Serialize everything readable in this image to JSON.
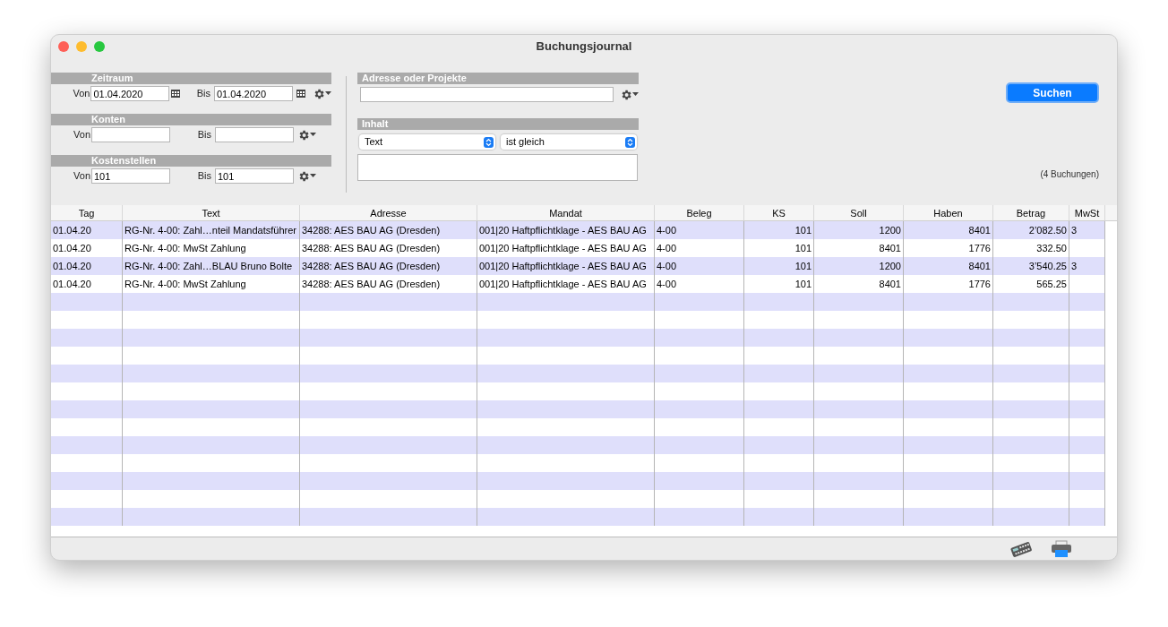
{
  "window": {
    "title": "Buchungsjournal"
  },
  "filters": [
    {
      "title": "Zeitraum",
      "from_label": "Von",
      "from_value": "01.04.2020",
      "to_label": "Bis",
      "to_value": "01.04.2020",
      "calendar": true
    },
    {
      "title": "Konten",
      "from_label": "Von",
      "to_label": "Bis",
      "calendar": false
    },
    {
      "title": "Kostenstellen",
      "from_label": "Von",
      "from_value": "101",
      "to_label": "Bis",
      "to_value": "101",
      "calendar": false
    }
  ],
  "address": {
    "title": "Adresse oder Projekte"
  },
  "content": {
    "title": "Inhalt",
    "field": "Text",
    "operator": "ist gleich"
  },
  "search_button": "Suchen",
  "result_count": "(4 Buchungen)",
  "table": {
    "columns": [
      {
        "label": "Tag",
        "kind": "text"
      },
      {
        "label": "Text",
        "kind": "text"
      },
      {
        "label": "Adresse",
        "kind": "text"
      },
      {
        "label": "Mandat",
        "kind": "text"
      },
      {
        "label": "Beleg",
        "kind": "text"
      },
      {
        "label": "KS",
        "kind": "number"
      },
      {
        "label": "Soll",
        "kind": "number"
      },
      {
        "label": "Haben",
        "kind": "number"
      },
      {
        "label": "Betrag",
        "kind": "number"
      },
      {
        "label": "MwSt",
        "kind": "text"
      }
    ],
    "rows": [
      [
        "01.04.20",
        "RG-Nr. 4-00: Zahl…nteil Mandatsführer",
        "34288: AES BAU AG (Dresden)",
        "001|20 Haftpflichtklage - AES BAU AG",
        "4-00",
        "101",
        "1200",
        "8401",
        "2’082.50",
        "3"
      ],
      [
        "01.04.20",
        "RG-Nr. 4-00: MwSt Zahlung",
        "34288: AES BAU AG (Dresden)",
        "001|20 Haftpflichtklage - AES BAU AG",
        "4-00",
        "101",
        "8401",
        "1776",
        "332.50",
        ""
      ],
      [
        "01.04.20",
        "RG-Nr. 4-00: Zahl…BLAU Bruno Bolte",
        "34288: AES BAU AG (Dresden)",
        "001|20 Haftpflichtklage - AES BAU AG",
        "4-00",
        "101",
        "1200",
        "8401",
        "3’540.25",
        "3"
      ],
      [
        "01.04.20",
        "RG-Nr. 4-00: MwSt Zahlung",
        "34288: AES BAU AG (Dresden)",
        "001|20 Haftpflichtklage - AES BAU AG",
        "4-00",
        "101",
        "8401",
        "1776",
        "565.25",
        ""
      ]
    ]
  }
}
